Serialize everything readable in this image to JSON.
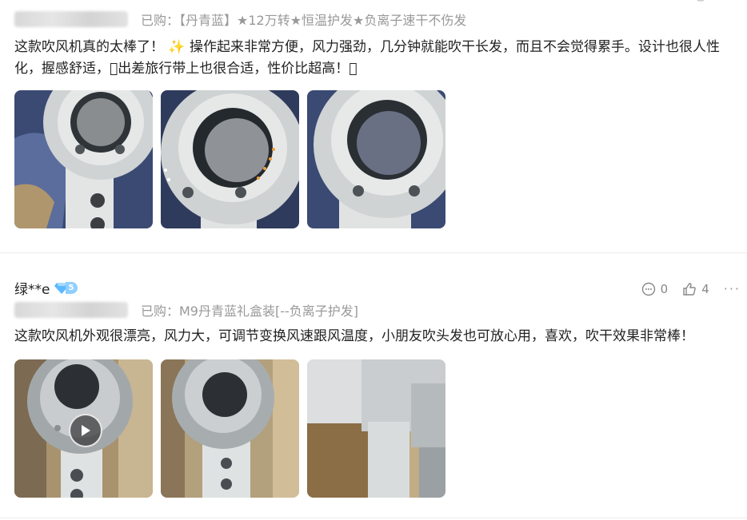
{
  "reviews": [
    {
      "variant": "已购：【丹青蓝】★12万转★恒温护发★负离子速干不伤发",
      "text": "这款吹风机真的太棒了！ ✨ 操作起来非常方便，风力强劲，几分钟就能吹干长发，而且不会觉得累手。设计也很人性化，握感舒适，\u0000出差旅行带上也很合适，性价比超高！\u0000"
    },
    {
      "username": "绿**e",
      "vip_level": "5",
      "comment_count": "0",
      "like_count": "4",
      "variant": "已购：M9丹青蓝礼盒装[--负离子护发]",
      "text": "这款吹风机外观很漂亮，风力大，可调节变换风速跟风温度，小朋友吹头发也可放心用，喜欢，吹干效果非常棒！"
    }
  ],
  "icons": {
    "comment": "comment-bubble-icon",
    "like": "thumbs-up-icon",
    "more": "more-dots-icon",
    "vip": "diamond-icon",
    "play": "play-icon"
  },
  "colors": {
    "meta_text": "#999999",
    "body_text": "#222222",
    "vip_badge": "#8fcfff",
    "divider": "#ececec"
  }
}
